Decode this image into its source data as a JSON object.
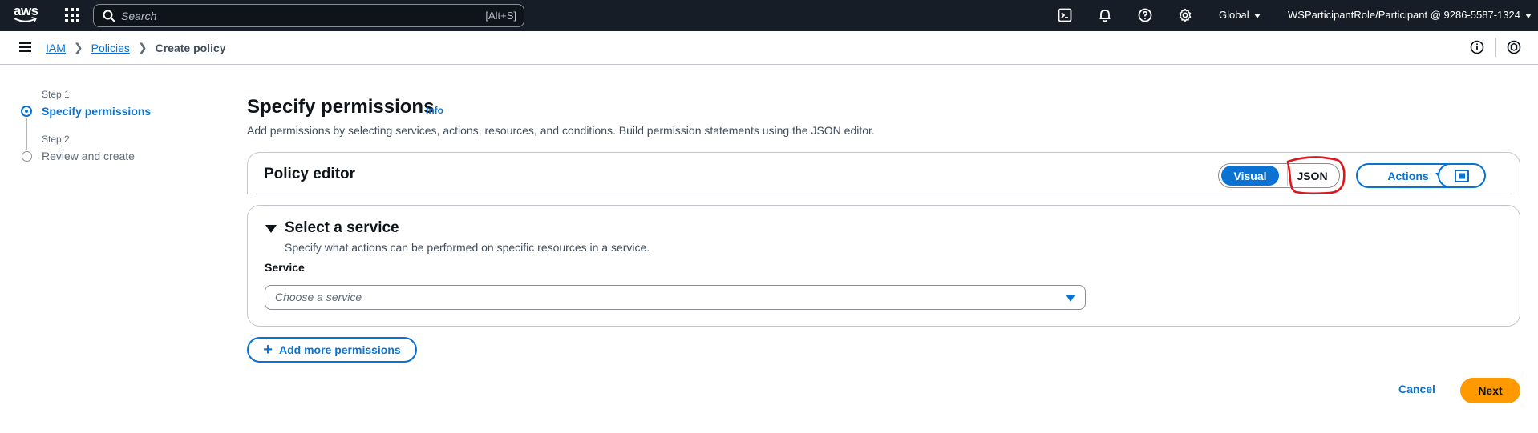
{
  "topbar": {
    "logo_text": "aws",
    "search_placeholder": "Search",
    "search_shortcut": "[Alt+S]",
    "region": "Global",
    "account": "WSParticipantRole/Participant @ 9286-5587-1324"
  },
  "breadcrumb": {
    "items": [
      "IAM",
      "Policies"
    ],
    "current": "Create policy"
  },
  "steps": [
    {
      "number": "Step 1",
      "label": "Specify permissions",
      "state": "active"
    },
    {
      "number": "Step 2",
      "label": "Review and create",
      "state": "inactive"
    }
  ],
  "main": {
    "title": "Specify permissions",
    "info_label": "Info",
    "description": "Add permissions by selecting services, actions, resources, and conditions. Build permission statements using the JSON editor.",
    "editor": {
      "title": "Policy editor",
      "mode_options": [
        "Visual",
        "JSON"
      ],
      "selected_mode": "Visual",
      "actions_label": "Actions"
    },
    "service_section": {
      "title": "Select a service",
      "description": "Specify what actions can be performed on specific resources in a service.",
      "field_label": "Service",
      "placeholder": "Choose a service"
    },
    "add_permissions_label": "Add more permissions"
  },
  "footer": {
    "cancel_label": "Cancel",
    "next_label": "Next"
  },
  "colors": {
    "topbar_bg": "#161d26",
    "link_blue": "#0972d3",
    "primary_orange": "#ff9900",
    "annotation_red": "#e0161f"
  }
}
